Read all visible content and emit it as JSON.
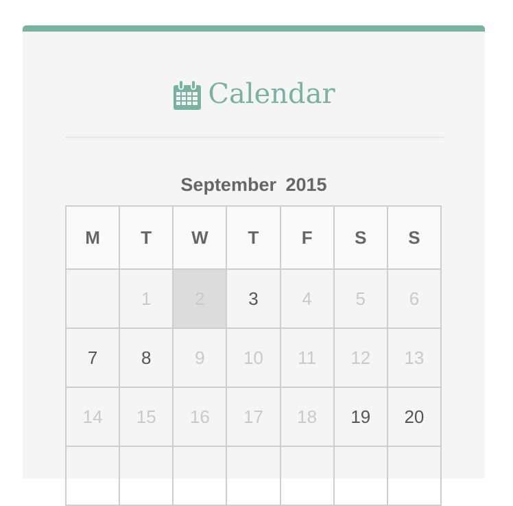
{
  "widget": {
    "title": "Calendar",
    "title_icon": "calendar-icon",
    "accent_color": "#79b2a1"
  },
  "calendar": {
    "month": "September",
    "year": "2015",
    "weekday_headers": [
      "M",
      "T",
      "W",
      "T",
      "F",
      "S",
      "S"
    ],
    "weeks": [
      [
        {
          "day": "",
          "has_post": false,
          "today": false
        },
        {
          "day": "1",
          "has_post": false,
          "today": false
        },
        {
          "day": "2",
          "has_post": false,
          "today": true
        },
        {
          "day": "3",
          "has_post": true,
          "today": false
        },
        {
          "day": "4",
          "has_post": false,
          "today": false
        },
        {
          "day": "5",
          "has_post": false,
          "today": false
        },
        {
          "day": "6",
          "has_post": false,
          "today": false
        }
      ],
      [
        {
          "day": "7",
          "has_post": true,
          "today": false
        },
        {
          "day": "8",
          "has_post": true,
          "today": false
        },
        {
          "day": "9",
          "has_post": false,
          "today": false
        },
        {
          "day": "10",
          "has_post": false,
          "today": false
        },
        {
          "day": "11",
          "has_post": false,
          "today": false
        },
        {
          "day": "12",
          "has_post": false,
          "today": false
        },
        {
          "day": "13",
          "has_post": false,
          "today": false
        }
      ],
      [
        {
          "day": "14",
          "has_post": false,
          "today": false
        },
        {
          "day": "15",
          "has_post": false,
          "today": false
        },
        {
          "day": "16",
          "has_post": false,
          "today": false
        },
        {
          "day": "17",
          "has_post": false,
          "today": false
        },
        {
          "day": "18",
          "has_post": false,
          "today": false
        },
        {
          "day": "19",
          "has_post": true,
          "today": false
        },
        {
          "day": "20",
          "has_post": true,
          "today": false
        }
      ],
      [
        {
          "day": "",
          "has_post": false,
          "today": false
        },
        {
          "day": "",
          "has_post": false,
          "today": false
        },
        {
          "day": "",
          "has_post": false,
          "today": false
        },
        {
          "day": "",
          "has_post": false,
          "today": false
        },
        {
          "day": "",
          "has_post": false,
          "today": false
        },
        {
          "day": "",
          "has_post": false,
          "today": false
        },
        {
          "day": "",
          "has_post": false,
          "today": false
        }
      ]
    ]
  }
}
